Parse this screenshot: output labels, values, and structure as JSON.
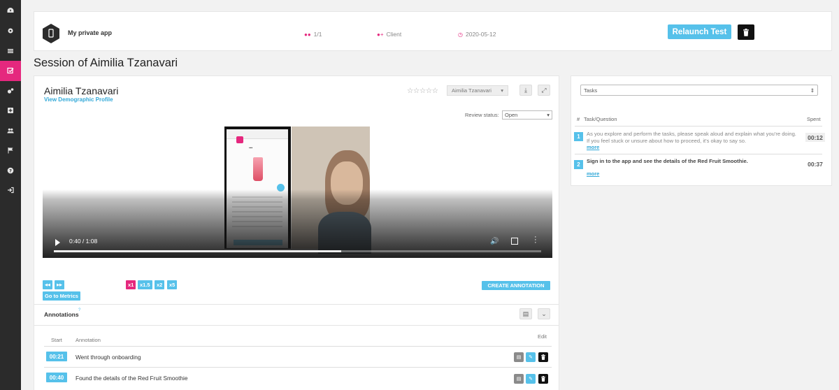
{
  "sidebar": {
    "items": [
      {
        "icon": "dashboard-icon"
      },
      {
        "icon": "gear-icon"
      },
      {
        "icon": "list-icon"
      },
      {
        "icon": "checkbox-icon",
        "active": true
      },
      {
        "icon": "cogs-icon"
      },
      {
        "icon": "plus-square-icon"
      },
      {
        "icon": "users-icon"
      },
      {
        "icon": "flag-icon"
      },
      {
        "icon": "help-icon"
      },
      {
        "icon": "sign-out-icon"
      }
    ]
  },
  "header": {
    "app_name": "My private app",
    "testers": "1/1",
    "client": "Client",
    "date": "2020-05-12",
    "relaunch_label": "Relaunch Test"
  },
  "session_title": "Session of Aimilia Tzanavari",
  "session": {
    "participant_name": "Aimilia Tzanavari",
    "demographic_link": "View Demographic Profile",
    "rating_stars": "☆☆☆☆☆",
    "reviewer": "Aimilia Tzanavari",
    "review_status_label": "Review status:",
    "review_status": "Open"
  },
  "video": {
    "time": "0:40 / 1:08",
    "progress_fraction": 0.59
  },
  "controls": {
    "rewind": "◀◀",
    "forward": "▶▶",
    "speeds": [
      "x1",
      "x1.5",
      "x2",
      "x5"
    ],
    "active_speed": "x1",
    "go_to_metrics": "Go to Metrics",
    "create_annotation": "CREATE ANNOTATION"
  },
  "annotations": {
    "title": "Annotations",
    "help": "?",
    "columns": {
      "start": "Start",
      "annotation": "Annotation",
      "edit": "Edit"
    },
    "rows": [
      {
        "start": "00:21",
        "text": "Went through onboarding"
      },
      {
        "start": "00:40",
        "text": "Found the details of the Red Fruit Smoothie"
      }
    ]
  },
  "tasks": {
    "selector": "Tasks",
    "columns": {
      "num": "#",
      "question": "Task/Question",
      "spent": "Spent"
    },
    "items": [
      {
        "num": "1",
        "text": "As you explore and perform the tasks, please speak aloud and explain what you're doing. If you feel stuck or unsure about how to proceed, it's okay to say so.",
        "more": "more",
        "spent": "00:12"
      },
      {
        "num": "2",
        "text": "Sign in to the app and see the details of the Red Fruit Smoothie.",
        "more": "more",
        "spent": "00:37"
      }
    ]
  },
  "colors": {
    "accent_blue": "#56c1ea",
    "accent_pink": "#e5287e",
    "sidebar_bg": "#2b2b2b"
  }
}
